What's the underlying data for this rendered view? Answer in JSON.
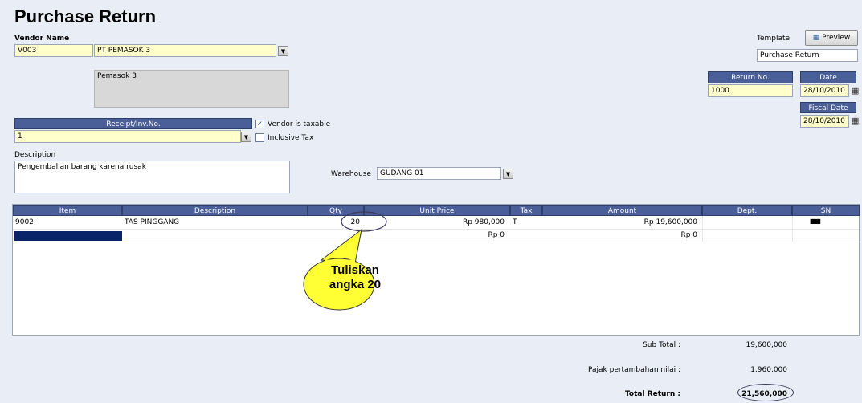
{
  "window": {
    "title": "Purchase Return"
  },
  "vendor": {
    "label": "Vendor Name",
    "code": "V003",
    "name": "PT PEMASOK 3",
    "address": "Pemasok 3",
    "address_marker": "3"
  },
  "template": {
    "label": "Template",
    "value": "Purchase Return",
    "preview_label": "Preview"
  },
  "return_no": {
    "label": "Return No.",
    "value": "1000"
  },
  "date": {
    "label": "Date",
    "value": "28/10/2010"
  },
  "fiscal_date": {
    "label": "Fiscal Date",
    "value": "28/10/2010"
  },
  "receipt": {
    "label": "Receipt/Inv.No.",
    "value": "1"
  },
  "options": {
    "vendor_taxable_label": "Vendor is taxable",
    "vendor_taxable_checked": true,
    "inclusive_tax_label": "Inclusive Tax",
    "inclusive_tax_checked": false
  },
  "description": {
    "label": "Description",
    "value": "Pengembalian barang karena rusak"
  },
  "warehouse": {
    "label": "Warehouse",
    "value": "GUDANG 01"
  },
  "grid": {
    "columns": [
      "Item",
      "Description",
      "Qty",
      "Unit Price",
      "Tax",
      "Amount",
      "Dept.",
      "SN"
    ],
    "rows": [
      {
        "item": "9002",
        "description": "TAS PINGGANG",
        "qty": "20",
        "unit_price": "Rp 980,000",
        "tax": "T",
        "amount": "Rp 19,600,000",
        "dept": "",
        "sn": "▮▮▮▮▮"
      },
      {
        "item": "",
        "description": "",
        "qty": "",
        "unit_price": "Rp 0",
        "tax": "",
        "amount": "Rp 0",
        "dept": "",
        "sn": ""
      }
    ]
  },
  "callout": {
    "line1": "Tuliskan",
    "line2": "angka 20"
  },
  "totals": {
    "subtotal_label": "Sub Total :",
    "subtotal_value": "19,600,000",
    "tax_label": "Pajak pertambahan nilai :",
    "tax_value": "1,960,000",
    "total_label": "Total Return :",
    "total_value": "21,560,000"
  },
  "colors": {
    "header": "#4a5f97",
    "field_yellow": "#ffffcc",
    "background": "#e9edf5",
    "callout": "#ffff33"
  }
}
